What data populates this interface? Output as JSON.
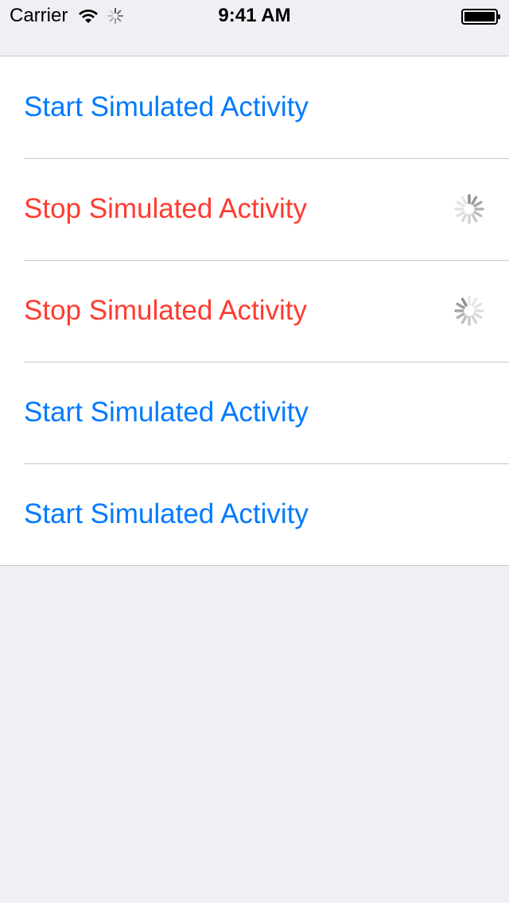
{
  "status_bar": {
    "carrier": "Carrier",
    "time": "9:41 AM",
    "icons": [
      "wifi-icon",
      "activity-spinner-icon",
      "battery-icon"
    ]
  },
  "colors": {
    "start": "#007aff",
    "stop": "#ff3b30",
    "separator": "#c8c7cc",
    "background": "#efeff4"
  },
  "rows": [
    {
      "label": "Start Simulated Activity",
      "state": "start",
      "spinner": false
    },
    {
      "label": "Stop Simulated Activity",
      "state": "stop",
      "spinner": true
    },
    {
      "label": "Stop Simulated Activity",
      "state": "stop",
      "spinner": true
    },
    {
      "label": "Start Simulated Activity",
      "state": "start",
      "spinner": false
    },
    {
      "label": "Start Simulated Activity",
      "state": "start",
      "spinner": false
    }
  ]
}
